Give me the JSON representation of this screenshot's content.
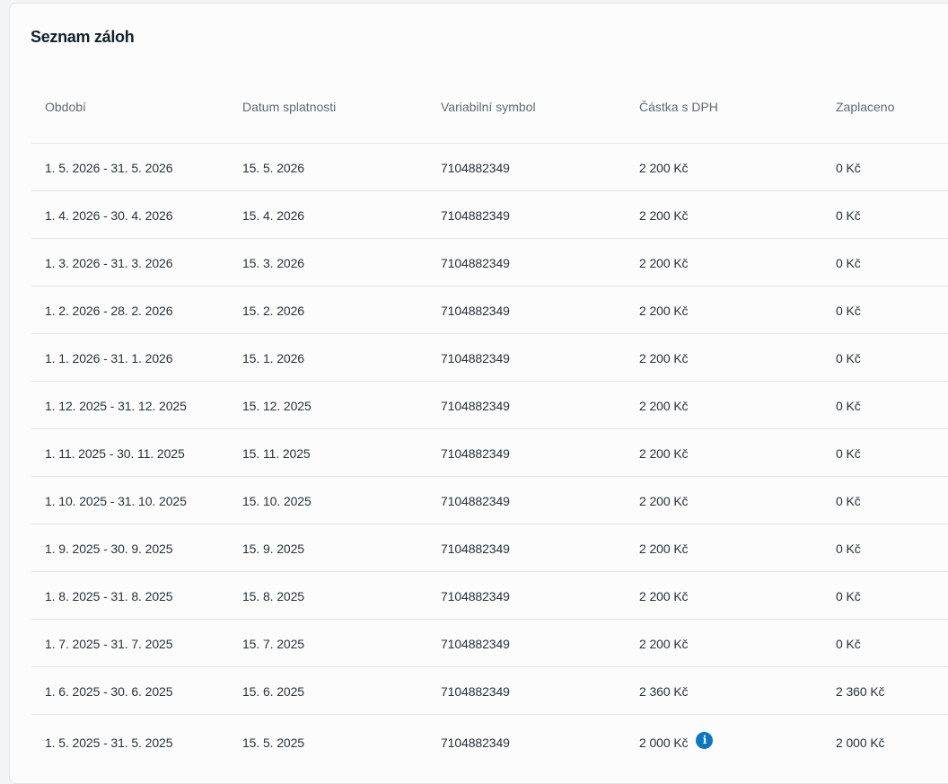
{
  "title": "Seznam záloh",
  "table": {
    "headers": [
      "Období",
      "Datum splatnosti",
      "Variabilní symbol",
      "Částka s DPH",
      "Zaplaceno"
    ],
    "rows": [
      {
        "period": "1. 5. 2026 - 31. 5. 2026",
        "due": "15. 5. 2026",
        "vs": "7104882349",
        "amount": "2 200 Kč",
        "paid": "0 Kč"
      },
      {
        "period": "1. 4. 2026 - 30. 4. 2026",
        "due": "15. 4. 2026",
        "vs": "7104882349",
        "amount": "2 200 Kč",
        "paid": "0 Kč"
      },
      {
        "period": "1. 3. 2026 - 31. 3. 2026",
        "due": "15. 3. 2026",
        "vs": "7104882349",
        "amount": "2 200 Kč",
        "paid": "0 Kč"
      },
      {
        "period": "1. 2. 2026 - 28. 2. 2026",
        "due": "15. 2. 2026",
        "vs": "7104882349",
        "amount": "2 200 Kč",
        "paid": "0 Kč"
      },
      {
        "period": "1. 1. 2026 - 31. 1. 2026",
        "due": "15. 1. 2026",
        "vs": "7104882349",
        "amount": "2 200 Kč",
        "paid": "0 Kč"
      },
      {
        "period": "1. 12. 2025 - 31. 12. 2025",
        "due": "15. 12. 2025",
        "vs": "7104882349",
        "amount": "2 200 Kč",
        "paid": "0 Kč"
      },
      {
        "period": "1. 11. 2025 - 30. 11. 2025",
        "due": "15. 11. 2025",
        "vs": "7104882349",
        "amount": "2 200 Kč",
        "paid": "0 Kč"
      },
      {
        "period": "1. 10. 2025 - 31. 10. 2025",
        "due": "15. 10. 2025",
        "vs": "7104882349",
        "amount": "2 200 Kč",
        "paid": "0 Kč"
      },
      {
        "period": "1. 9. 2025 - 30. 9. 2025",
        "due": "15. 9. 2025",
        "vs": "7104882349",
        "amount": "2 200 Kč",
        "paid": "0 Kč"
      },
      {
        "period": "1. 8. 2025 - 31. 8. 2025",
        "due": "15. 8. 2025",
        "vs": "7104882349",
        "amount": "2 200 Kč",
        "paid": "0 Kč"
      },
      {
        "period": "1. 7. 2025 - 31. 7. 2025",
        "due": "15. 7. 2025",
        "vs": "7104882349",
        "amount": "2 200 Kč",
        "paid": "0 Kč"
      },
      {
        "period": "1. 6. 2025 - 30. 6. 2025",
        "due": "15. 6. 2025",
        "vs": "7104882349",
        "amount": "2 360 Kč",
        "paid": "2 360 Kč"
      },
      {
        "period": "1. 5. 2025 - 31. 5. 2025",
        "due": "15. 5. 2025",
        "vs": "7104882349",
        "amount": "2 000 Kč",
        "paid": "2 000 Kč",
        "info_icon": "info-icon"
      }
    ]
  },
  "info_icon_glyph": "i",
  "colors": {
    "accent": "#0a78c2",
    "text": "#26323b",
    "muted": "#5f6b74",
    "border": "#e3e5e7"
  }
}
